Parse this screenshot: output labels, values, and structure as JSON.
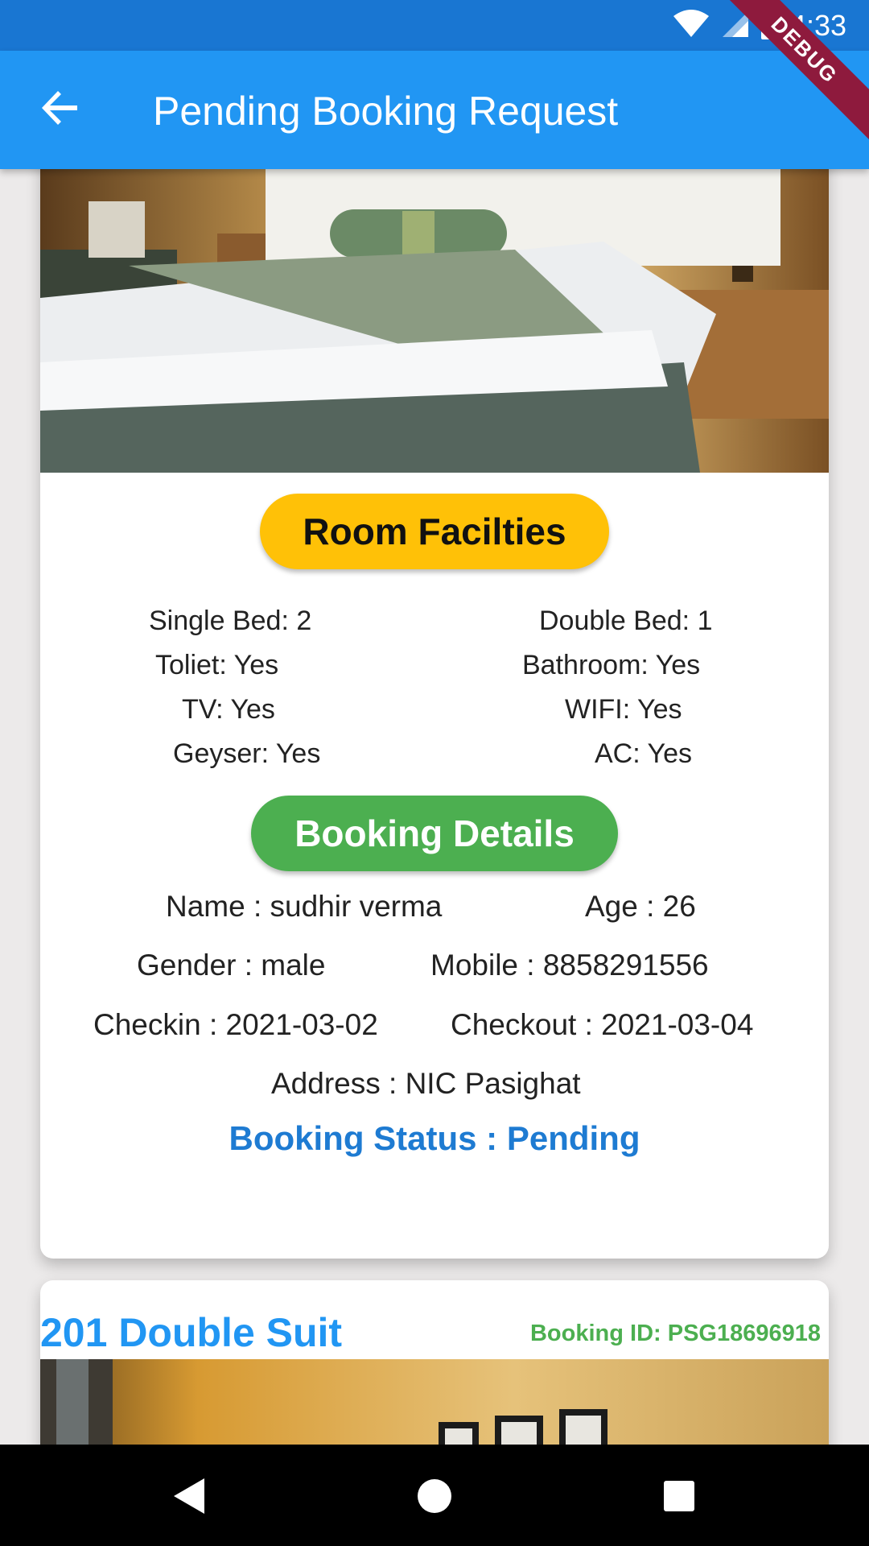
{
  "status_bar": {
    "time": "4:33",
    "icons": [
      "wifi-icon",
      "signal-icon",
      "battery-charging-icon"
    ]
  },
  "debug_banner": "DEBUG",
  "app_bar": {
    "title": "Pending Booking Request",
    "back_icon": "arrow-back-icon"
  },
  "booking_card": {
    "facilities_title": "Room Facilties",
    "facilities": {
      "single_bed": "Single Bed: 2",
      "double_bed": "Double Bed: 1",
      "toilet": "Toliet: Yes",
      "bathroom": "Bathroom: Yes",
      "tv": "TV: Yes",
      "wifi": "WIFI: Yes",
      "geyser": "Geyser: Yes",
      "ac": "AC: Yes"
    },
    "details_title": "Booking Details",
    "details": {
      "name": "Name : sudhir verma",
      "age": "Age : 26",
      "gender": "Gender : male",
      "mobile": "Mobile : 8858291556",
      "checkin": "Checkin : 2021-03-02",
      "checkout": "Checkout : 2021-03-04",
      "address": "Address : NIC Pasighat"
    },
    "status": "Booking Status : Pending"
  },
  "next_card": {
    "room_name": "201 Double Suit",
    "booking_id": "Booking ID: PSG18696918"
  },
  "colors": {
    "status_bar": "#1976d2",
    "app_bar": "#2196f3",
    "facilities_pill": "#ffc107",
    "booking_pill": "#4caf50",
    "status_text": "#1e7bd2",
    "booking_id": "#4caf50"
  },
  "nav_icons": [
    "back-triangle-icon",
    "home-circle-icon",
    "recents-square-icon"
  ]
}
